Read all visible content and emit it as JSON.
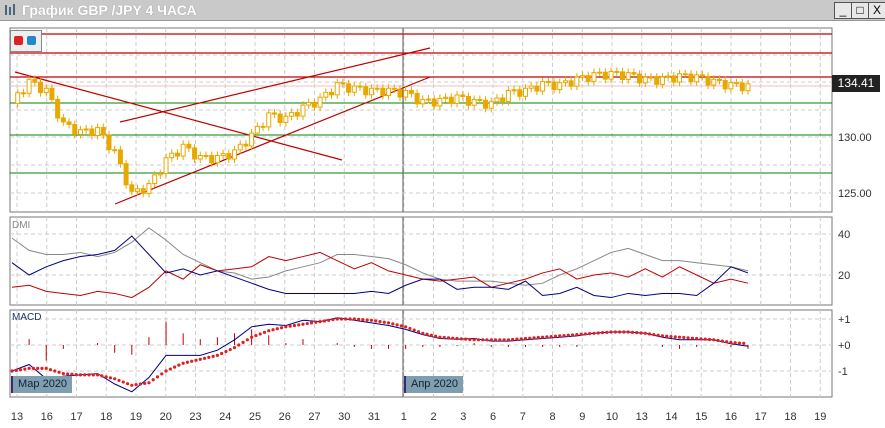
{
  "window": {
    "title": "График GBP /JPY  4 ЧАСА",
    "min": "_",
    "max": "□",
    "close": "X"
  },
  "price_axis": {
    "labels": [
      "130.00",
      "125.00"
    ],
    "current": "134.41"
  },
  "dmi": {
    "label": "DMI",
    "levels": [
      "40",
      "20"
    ]
  },
  "macd": {
    "label": "MACD",
    "levels": [
      "+1",
      "+0",
      "-1"
    ]
  },
  "date_tags": [
    "Мар 2020",
    "Апр 2020"
  ],
  "x_labels": [
    "13",
    "16",
    "17",
    "18",
    "19",
    "20",
    "23",
    "24",
    "25",
    "26",
    "27",
    "30",
    "31",
    "1",
    "2",
    "3",
    "6",
    "7",
    "8",
    "9",
    "10",
    "13",
    "14",
    "15",
    "16",
    "17",
    "18",
    "19"
  ],
  "colors": {
    "candle": "#e8a800",
    "red": "#c00000",
    "green": "#008000",
    "blue": "#000080",
    "adx": "#888888"
  },
  "chart_data": {
    "type": "line",
    "price_closes": [
      133,
      134.8,
      134,
      131,
      130.3,
      130.5,
      128.5,
      124.8,
      125.5,
      127.8,
      129,
      128,
      128,
      128.5,
      130,
      131.8,
      131.5,
      132.5,
      133.2,
      134.5,
      134.2,
      134,
      134,
      133.8,
      133,
      133.1,
      133.4,
      133,
      132.8,
      133.8,
      134,
      134.6,
      134.5,
      135,
      135.4,
      135.5,
      135.4,
      135,
      135,
      135.3,
      135.2,
      134.8,
      134.5,
      134.4
    ],
    "dmi_adx": [
      38,
      32,
      30,
      30,
      31,
      29,
      31,
      36,
      43,
      37,
      30,
      26,
      22,
      21,
      18,
      19,
      22,
      24,
      26,
      30,
      30,
      29,
      28,
      25,
      21,
      18,
      17,
      17,
      17,
      16,
      15,
      16,
      20,
      23,
      27,
      31,
      33,
      30,
      27,
      27,
      26,
      25,
      24,
      22
    ],
    "dmi_plus": [
      14,
      15,
      12,
      11,
      10,
      12,
      11,
      9,
      14,
      22,
      18,
      25,
      22,
      23,
      24,
      29,
      27,
      29,
      31,
      27,
      23,
      26,
      22,
      20,
      18,
      17,
      18,
      19,
      14,
      16,
      18,
      21,
      23,
      18,
      20,
      21,
      19,
      23,
      19,
      24,
      20,
      16,
      18,
      16
    ],
    "dmi_minus": [
      26,
      20,
      24,
      27,
      29,
      30,
      32,
      39,
      30,
      21,
      23,
      20,
      22,
      19,
      16,
      13,
      11,
      11,
      11,
      11,
      11,
      12,
      11,
      15,
      18,
      18,
      13,
      14,
      14,
      13,
      17,
      10,
      11,
      14,
      10,
      9,
      11,
      10,
      11,
      11,
      10,
      16,
      24,
      21
    ],
    "macd": [
      -1,
      -0.75,
      -1.3,
      -1.2,
      -1.15,
      -1.1,
      -1.5,
      -1.8,
      -1.25,
      -0.4,
      -0.4,
      -0.4,
      -0.2,
      0.2,
      0.7,
      0.8,
      0.75,
      0.95,
      0.9,
      1.05,
      0.95,
      0.85,
      0.75,
      0.6,
      0.4,
      0.25,
      0.22,
      0.25,
      0.15,
      0.15,
      0.2,
      0.25,
      0.3,
      0.35,
      0.45,
      0.5,
      0.5,
      0.45,
      0.3,
      0.2,
      0.2,
      0.2,
      0.05,
      -0.05
    ],
    "signal": [
      -1,
      -0.9,
      -0.9,
      -1.1,
      -1.15,
      -1.15,
      -1.3,
      -1.55,
      -1.45,
      -1,
      -0.7,
      -0.55,
      -0.4,
      -0.1,
      0.3,
      0.55,
      0.7,
      0.8,
      0.9,
      1,
      1,
      0.95,
      0.85,
      0.7,
      0.45,
      0.3,
      0.25,
      0.2,
      0.2,
      0.2,
      0.25,
      0.3,
      0.35,
      0.4,
      0.45,
      0.5,
      0.5,
      0.45,
      0.35,
      0.3,
      0.25,
      0.2,
      0.1,
      0.05
    ],
    "price_ylim": [
      123,
      138
    ],
    "dmi_ylim": [
      0,
      45
    ],
    "macd_ylim": [
      -2,
      1.2
    ]
  }
}
